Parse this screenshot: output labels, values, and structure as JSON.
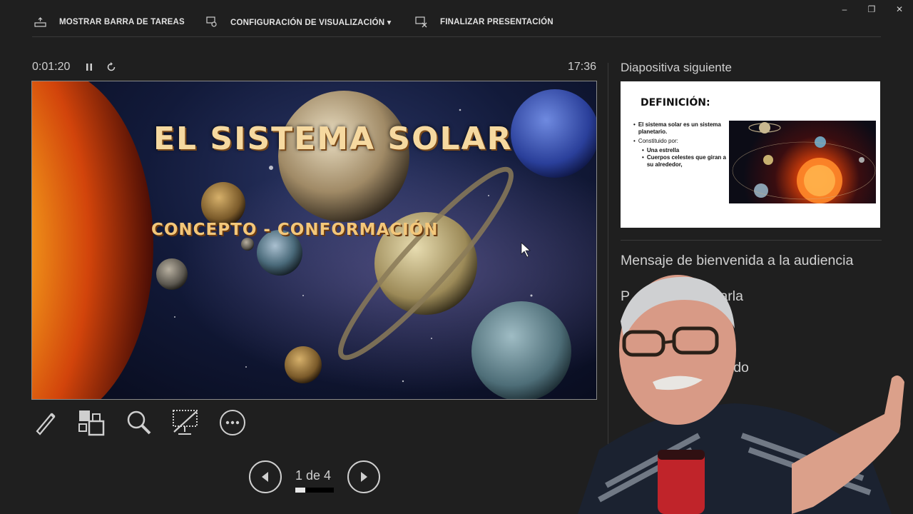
{
  "toolbar": {
    "show_taskbar": "MOSTRAR BARRA DE TAREAS",
    "display_settings": "CONFIGURACIÓN DE VISUALIZACIÓN ▾",
    "end_show": "FINALIZAR PRESENTACIÓN"
  },
  "window": {
    "minimize": "–",
    "restore": "❐",
    "close": "✕"
  },
  "timer": {
    "elapsed": "0:01:20",
    "clock": "17:36"
  },
  "current_slide": {
    "title": "EL SISTEMA SOLAR",
    "subtitle": "CONCEPTO - CONFORMACIÓN"
  },
  "next_slide": {
    "label": "Diapositiva siguiente",
    "title": "DEFINICIÓN:",
    "bullet1": "El sistema solar es un sistema planetario.",
    "bullet2": "Constituido por:",
    "sub1": "Una estrella",
    "sub2": "Cuerpos celestes que giran a su alrededor,"
  },
  "notes": {
    "line1": "Mensaje de bienvenida a la audiencia",
    "line2": "P          de la Charla",
    "line3": "",
    "line4": "M               mo orado"
  },
  "navigation": {
    "page_indicator": "1 de 4",
    "progress": 0.25
  },
  "colors": {
    "background": "#1f1f1f",
    "text": "#d6d6d6",
    "accent_title": "#f6d9a0"
  }
}
